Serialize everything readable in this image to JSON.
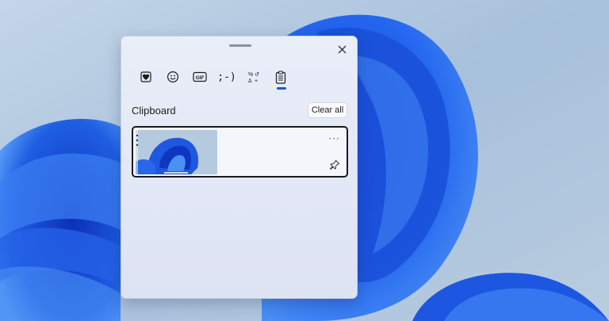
{
  "colors": {
    "accent": "#0a5cc9",
    "desktop_bg": "#a9c2da",
    "bloom_blue": "#1f5fe3"
  },
  "panel": {
    "close_icon": "close-icon",
    "tabs": [
      {
        "id": "favorites",
        "icon": "heart-favorites-icon"
      },
      {
        "id": "emoji",
        "icon": "smiley-emoji-icon"
      },
      {
        "id": "gif",
        "icon": "gif-icon",
        "label": "GIF"
      },
      {
        "id": "kaomoji",
        "icon": "kaomoji-icon",
        "label": ";-)"
      },
      {
        "id": "symbols",
        "icon": "symbols-icon"
      },
      {
        "id": "clipboard",
        "icon": "clipboard-icon",
        "active": true
      }
    ],
    "section_title": "Clipboard",
    "clear_all": "Clear all",
    "items": [
      {
        "type": "image",
        "thumbnail": "windows-bloom-wallpaper",
        "more": "···",
        "pin_icon": "pin-icon"
      }
    ]
  }
}
